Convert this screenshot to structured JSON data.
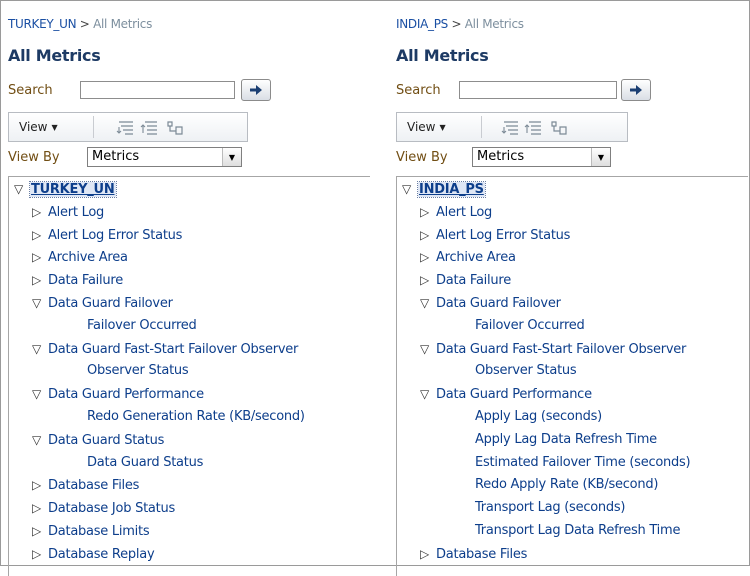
{
  "left": {
    "breadcrumb": {
      "target": "TURKEY_UN",
      "separator": " > ",
      "current": "All Metrics"
    },
    "title": "All Metrics",
    "search": {
      "label": "Search",
      "value": ""
    },
    "toolbar": {
      "view_label": "View"
    },
    "viewby": {
      "label": "View By",
      "selected": "Metrics"
    },
    "tree": {
      "root": "TURKEY_UN",
      "items": [
        {
          "label": "Alert Log",
          "level": 1,
          "state": "collapsed"
        },
        {
          "label": "Alert Log Error Status",
          "level": 1,
          "state": "collapsed"
        },
        {
          "label": "Archive Area",
          "level": 1,
          "state": "collapsed"
        },
        {
          "label": "Data Failure",
          "level": 1,
          "state": "collapsed"
        },
        {
          "label": "Data Guard Failover",
          "level": 1,
          "state": "expanded"
        },
        {
          "label": "Failover Occurred",
          "level": 2,
          "state": "leaf"
        },
        {
          "label": "Data Guard Fast-Start Failover Observer",
          "level": 1,
          "state": "expanded"
        },
        {
          "label": "Observer Status",
          "level": 2,
          "state": "leaf"
        },
        {
          "label": "Data Guard Performance",
          "level": 1,
          "state": "expanded"
        },
        {
          "label": "Redo Generation Rate (KB/second)",
          "level": 2,
          "state": "leaf"
        },
        {
          "label": "Data Guard Status",
          "level": 1,
          "state": "expanded"
        },
        {
          "label": "Data Guard Status",
          "level": 2,
          "state": "leaf"
        },
        {
          "label": "Database Files",
          "level": 1,
          "state": "collapsed"
        },
        {
          "label": "Database Job Status",
          "level": 1,
          "state": "collapsed"
        },
        {
          "label": "Database Limits",
          "level": 1,
          "state": "collapsed"
        },
        {
          "label": "Database Replay",
          "level": 1,
          "state": "collapsed"
        }
      ]
    }
  },
  "right": {
    "breadcrumb": {
      "target": "INDIA_PS",
      "separator": " > ",
      "current": "All Metrics"
    },
    "title": "All Metrics",
    "search": {
      "label": "Search",
      "value": ""
    },
    "toolbar": {
      "view_label": "View"
    },
    "viewby": {
      "label": "View By",
      "selected": "Metrics"
    },
    "tree": {
      "root": "INDIA_PS",
      "items": [
        {
          "label": "Alert Log",
          "level": 1,
          "state": "collapsed"
        },
        {
          "label": "Alert Log Error Status",
          "level": 1,
          "state": "collapsed"
        },
        {
          "label": "Archive Area",
          "level": 1,
          "state": "collapsed"
        },
        {
          "label": "Data Failure",
          "level": 1,
          "state": "collapsed"
        },
        {
          "label": "Data Guard Failover",
          "level": 1,
          "state": "expanded"
        },
        {
          "label": "Failover Occurred",
          "level": 2,
          "state": "leaf"
        },
        {
          "label": "Data Guard Fast-Start Failover Observer",
          "level": 1,
          "state": "expanded"
        },
        {
          "label": "Observer Status",
          "level": 2,
          "state": "leaf"
        },
        {
          "label": "Data Guard Performance",
          "level": 1,
          "state": "expanded"
        },
        {
          "label": "Apply Lag (seconds)",
          "level": 2,
          "state": "leaf"
        },
        {
          "label": "Apply Lag Data Refresh Time",
          "level": 2,
          "state": "leaf"
        },
        {
          "label": "Estimated Failover Time (seconds)",
          "level": 2,
          "state": "leaf"
        },
        {
          "label": "Redo Apply Rate (KB/second)",
          "level": 2,
          "state": "leaf"
        },
        {
          "label": "Transport Lag (seconds)",
          "level": 2,
          "state": "leaf"
        },
        {
          "label": "Transport Lag Data Refresh Time",
          "level": 2,
          "state": "leaf"
        },
        {
          "label": "Database Files",
          "level": 1,
          "state": "collapsed"
        }
      ]
    }
  },
  "icons": {
    "collapsed": "collapsed-triangle-icon",
    "expanded": "expanded-triangle-icon",
    "go": "go-arrow-icon",
    "expand_all": "expand-all-icon",
    "collapse_all": "collapse-all-icon",
    "focus": "focus-icon"
  },
  "colors": {
    "link": "#0d3e8b",
    "label": "#714e14",
    "title": "#1d3a64",
    "selected_bg": "#dfe7f5"
  }
}
